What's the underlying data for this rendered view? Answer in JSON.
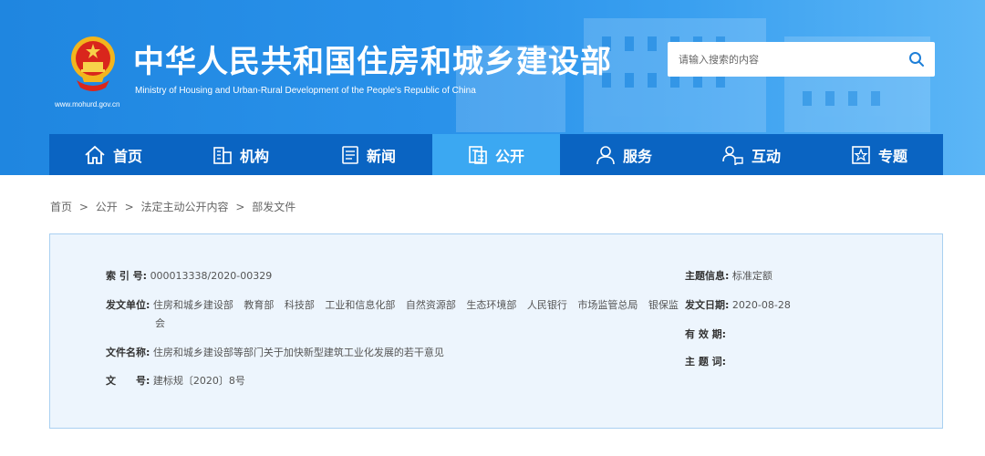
{
  "header": {
    "title": "中华人民共和国住房和城乡建设部",
    "subtitle": "Ministry of Housing and Urban-Rural Development of the People's Republic of China",
    "url": "www.mohurd.gov.cn",
    "emblem_icon": "national-emblem-icon",
    "colors": {
      "header_blue": "#2a92ea",
      "nav_blue": "#0a64c2",
      "nav_active": "#3ba8f2"
    }
  },
  "search": {
    "placeholder": "请输入搜索的内容",
    "icon": "search-icon"
  },
  "nav": {
    "items": [
      {
        "label": "首页",
        "icon": "home-icon"
      },
      {
        "label": "机构",
        "icon": "building-icon"
      },
      {
        "label": "新闻",
        "icon": "news-icon"
      },
      {
        "label": "公开",
        "icon": "document-icon",
        "active": true
      },
      {
        "label": "服务",
        "icon": "person-icon"
      },
      {
        "label": "互动",
        "icon": "interact-icon"
      },
      {
        "label": "专题",
        "icon": "topic-icon"
      }
    ]
  },
  "breadcrumb": {
    "items": [
      "首页",
      "公开",
      "法定主动公开内容",
      "部发文件"
    ],
    "separator": ">"
  },
  "info": {
    "index_label": "索 引 号:",
    "index_value": "000013338/2020-00329",
    "issuer_label": "发文单位:",
    "issuers": [
      "住房和城乡建设部",
      "教育部",
      "科技部",
      "工业和信息化部",
      "自然资源部",
      "生态环境部",
      "人民银行",
      "市场监管总局",
      "银保监"
    ],
    "issuers_wrap": "会",
    "doc_name_label": "文件名称:",
    "doc_name_value": "住房和城乡建设部等部门关于加快新型建筑工业化发展的若干意见",
    "doc_no_label": "文　　号:",
    "doc_no_value": "建标规〔2020〕8号",
    "topic_label": "主题信息:",
    "topic_value": "标准定额",
    "date_label": "发文日期:",
    "date_value": "2020-08-28",
    "validity_label": "有 效 期:",
    "validity_value": "",
    "keywords_label": "主 题 词:",
    "keywords_value": ""
  }
}
